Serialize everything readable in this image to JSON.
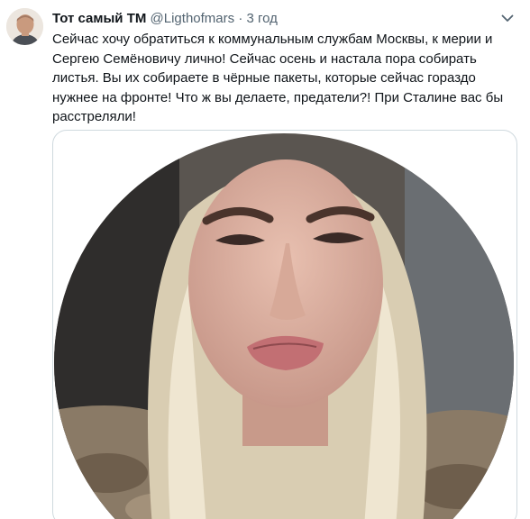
{
  "tweet": {
    "author": {
      "display_name": "Тот самый",
      "badge": "ТМ",
      "handle": "@Ligthofmars",
      "separator": "·",
      "time": "3 год"
    },
    "text": "Сейчас хочу обратиться к коммунальным службам Москвы, к мерии и Сергею Семёновичу лично! Сейчас осень и настала пора собирать листья. Вы их собираете в чёрные пакеты, которые сейчас гораздо нужнее на фронте! Что ж вы делаете, предатели?! При Сталине вас бы расстреляли!",
    "icons": {
      "more": "chevron-down-icon"
    },
    "media": {
      "type": "video-still",
      "shape": "circle"
    }
  },
  "colors": {
    "text": "#0f1419",
    "secondary_text": "#536471",
    "border": "#cfd9de",
    "background": "#ffffff"
  }
}
